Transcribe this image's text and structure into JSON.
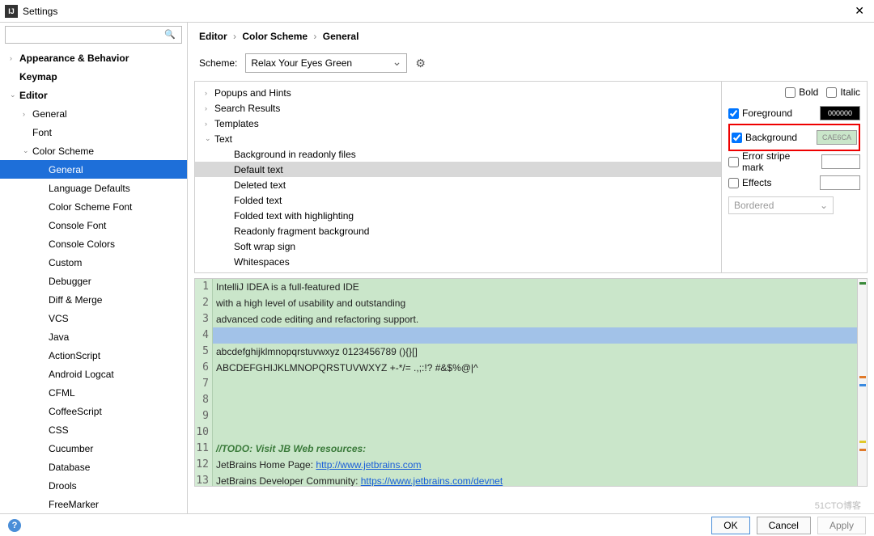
{
  "window": {
    "title": "Settings"
  },
  "search": {
    "placeholder": ""
  },
  "sidebar": [
    {
      "label": "Appearance & Behavior",
      "lvl": 0,
      "caret": "›",
      "bold": true
    },
    {
      "label": "Keymap",
      "lvl": 0,
      "caret": "",
      "bold": true
    },
    {
      "label": "Editor",
      "lvl": 0,
      "caret": "⌄",
      "bold": true
    },
    {
      "label": "General",
      "lvl": 1,
      "caret": "›"
    },
    {
      "label": "Font",
      "lvl": 1,
      "caret": ""
    },
    {
      "label": "Color Scheme",
      "lvl": 1,
      "caret": "⌄"
    },
    {
      "label": "General",
      "lvl": 2,
      "caret": "",
      "selected": true
    },
    {
      "label": "Language Defaults",
      "lvl": 2,
      "caret": ""
    },
    {
      "label": "Color Scheme Font",
      "lvl": 2,
      "caret": ""
    },
    {
      "label": "Console Font",
      "lvl": 2,
      "caret": ""
    },
    {
      "label": "Console Colors",
      "lvl": 2,
      "caret": ""
    },
    {
      "label": "Custom",
      "lvl": 2,
      "caret": ""
    },
    {
      "label": "Debugger",
      "lvl": 2,
      "caret": ""
    },
    {
      "label": "Diff & Merge",
      "lvl": 2,
      "caret": ""
    },
    {
      "label": "VCS",
      "lvl": 2,
      "caret": ""
    },
    {
      "label": "Java",
      "lvl": 2,
      "caret": ""
    },
    {
      "label": "ActionScript",
      "lvl": 2,
      "caret": ""
    },
    {
      "label": "Android Logcat",
      "lvl": 2,
      "caret": ""
    },
    {
      "label": "CFML",
      "lvl": 2,
      "caret": ""
    },
    {
      "label": "CoffeeScript",
      "lvl": 2,
      "caret": ""
    },
    {
      "label": "CSS",
      "lvl": 2,
      "caret": ""
    },
    {
      "label": "Cucumber",
      "lvl": 2,
      "caret": ""
    },
    {
      "label": "Database",
      "lvl": 2,
      "caret": ""
    },
    {
      "label": "Drools",
      "lvl": 2,
      "caret": ""
    },
    {
      "label": "FreeMarker",
      "lvl": 2,
      "caret": ""
    }
  ],
  "breadcrumb": [
    "Editor",
    "Color Scheme",
    "General"
  ],
  "scheme": {
    "label": "Scheme:",
    "value": "Relax Your Eyes Green"
  },
  "elements": [
    {
      "label": "Popups and Hints",
      "lvl": 0,
      "caret": "›"
    },
    {
      "label": "Search Results",
      "lvl": 0,
      "caret": "›"
    },
    {
      "label": "Templates",
      "lvl": 0,
      "caret": "›"
    },
    {
      "label": "Text",
      "lvl": 0,
      "caret": "⌄"
    },
    {
      "label": "Background in readonly files",
      "lvl": 1,
      "caret": ""
    },
    {
      "label": "Default text",
      "lvl": 1,
      "caret": "",
      "selected": true
    },
    {
      "label": "Deleted text",
      "lvl": 1,
      "caret": ""
    },
    {
      "label": "Folded text",
      "lvl": 1,
      "caret": ""
    },
    {
      "label": "Folded text with highlighting",
      "lvl": 1,
      "caret": ""
    },
    {
      "label": "Readonly fragment background",
      "lvl": 1,
      "caret": ""
    },
    {
      "label": "Soft wrap sign",
      "lvl": 1,
      "caret": ""
    },
    {
      "label": "Whitespaces",
      "lvl": 1,
      "caret": ""
    }
  ],
  "props": {
    "bold": "Bold",
    "italic": "Italic",
    "foreground": "Foreground",
    "fg_color": "000000",
    "background": "Background",
    "bg_color": "CAE6CA",
    "error_stripe": "Error stripe mark",
    "effects": "Effects",
    "effects_type": "Bordered"
  },
  "preview": {
    "lines": [
      "IntelliJ IDEA is a full-featured IDE",
      "with a high level of usability and outstanding",
      "advanced code editing and refactoring support.",
      "",
      "abcdefghijklmnopqrstuvwxyz 0123456789 (){}[]",
      "ABCDEFGHIJKLMNOPQRSTUVWXYZ +-*/= .,;:!? #&$%@|^",
      "",
      "",
      "",
      "",
      "//TODO: Visit JB Web resources:",
      "JetBrains Home Page: http://www.jetbrains.com",
      "JetBrains Developer Community: https://www.jetbrains.com/devnet"
    ],
    "line12_prefix": "JetBrains Home Page: ",
    "line12_link": "http://www.jetbrains.com",
    "line13_prefix": "JetBrains Developer Community: ",
    "line13_link": "https://www.jetbrains.com/devnet"
  },
  "footer": {
    "ok": "OK",
    "cancel": "Cancel",
    "apply": "Apply"
  },
  "watermark": "51CTO博客"
}
